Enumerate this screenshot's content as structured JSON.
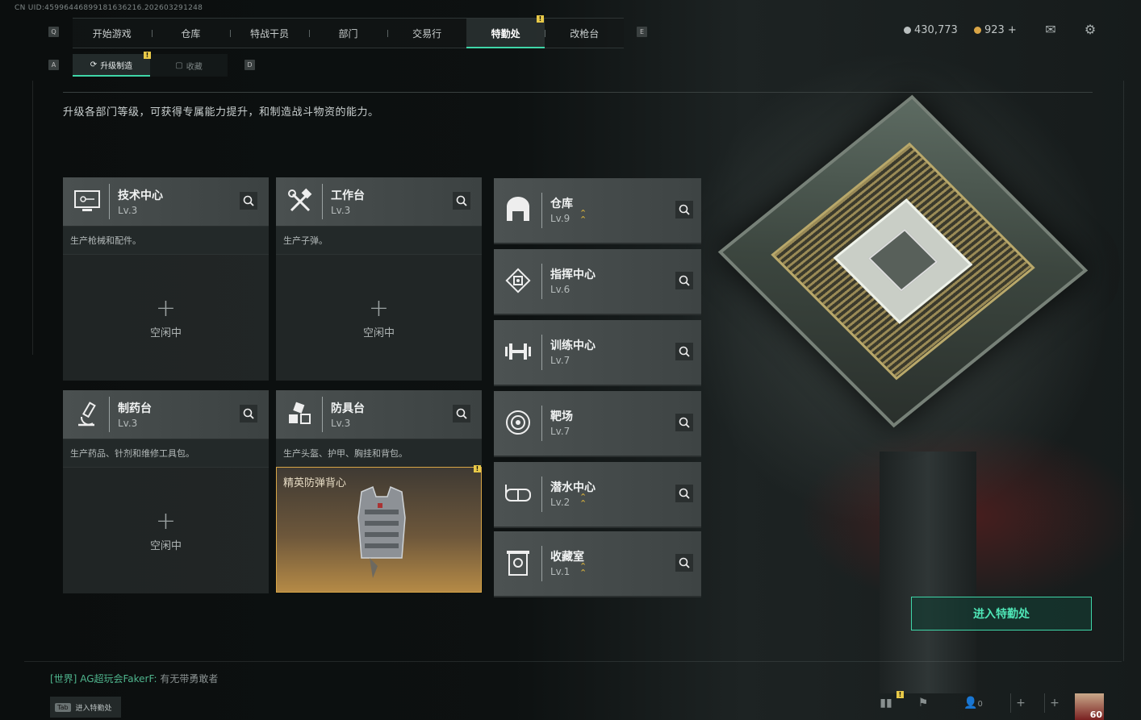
{
  "uid": "CN UID:4599644689918163621​6.202603291248",
  "top_nav": {
    "left_key": "Q",
    "right_key": "E",
    "tabs": [
      {
        "label": "开始游戏"
      },
      {
        "label": "仓库"
      },
      {
        "label": "特战干员"
      },
      {
        "label": "部门"
      },
      {
        "label": "交易行"
      },
      {
        "label": "特勤处",
        "active": true,
        "badge": "!"
      },
      {
        "label": "改枪台"
      }
    ]
  },
  "currency": {
    "silver": "430,773",
    "gold": "923",
    "gold_add": "+"
  },
  "sub_nav": {
    "left_key": "A",
    "right_key": "D",
    "tabs": [
      {
        "label": "升级制造",
        "active": true,
        "badge": "!"
      },
      {
        "label": "收藏"
      }
    ]
  },
  "description": "升级各部门等级，可获得专属能力提升，和制造战斗物资的能力。",
  "production_cards": [
    {
      "name": "技术中心",
      "level": "Lv.3",
      "sub": "生产枪械和配件。",
      "status": "空闲中",
      "icon": "monitor-icon"
    },
    {
      "name": "工作台",
      "level": "Lv.3",
      "sub": "生产子弹。",
      "status": "空闲中",
      "icon": "hammer-wrench-icon"
    },
    {
      "name": "制药台",
      "level": "Lv.3",
      "sub": "生产药品、针剂和维修工具包。",
      "status": "空闲中",
      "icon": "microscope-icon"
    },
    {
      "name": "防具台",
      "level": "Lv.3",
      "sub": "生产头盔、护甲、胸挂和背包。",
      "item": "精英防弹背心",
      "badge": "!",
      "icon": "cubes-icon"
    }
  ],
  "department_list": [
    {
      "name": "仓库",
      "level": "Lv.9",
      "upgradable": true,
      "icon": "warehouse-icon"
    },
    {
      "name": "指挥中心",
      "level": "Lv.6",
      "upgradable": false,
      "icon": "command-icon"
    },
    {
      "name": "训练中心",
      "level": "Lv.7",
      "upgradable": false,
      "icon": "dumbbell-icon"
    },
    {
      "name": "靶场",
      "level": "Lv.7",
      "upgradable": false,
      "icon": "target-icon"
    },
    {
      "name": "潜水中心",
      "level": "Lv.2",
      "upgradable": true,
      "icon": "diving-mask-icon"
    },
    {
      "name": "收藏室",
      "level": "Lv.1",
      "upgradable": true,
      "icon": "collection-icon"
    }
  ],
  "enter_button": "进入特勤处",
  "chat": {
    "channel": "[世界]",
    "sender": "AG超玩会FakerF:",
    "message": "有无带勇敢者"
  },
  "tab_hint": {
    "key": "Tab",
    "label": "进入特勤处"
  },
  "bottom_bar": {
    "friends_count": "0",
    "avatar_level": "60",
    "badge": "!"
  },
  "colors": {
    "accent": "#3fd6a8",
    "badge": "#e8c948",
    "upgrade": "#e0b83c"
  }
}
